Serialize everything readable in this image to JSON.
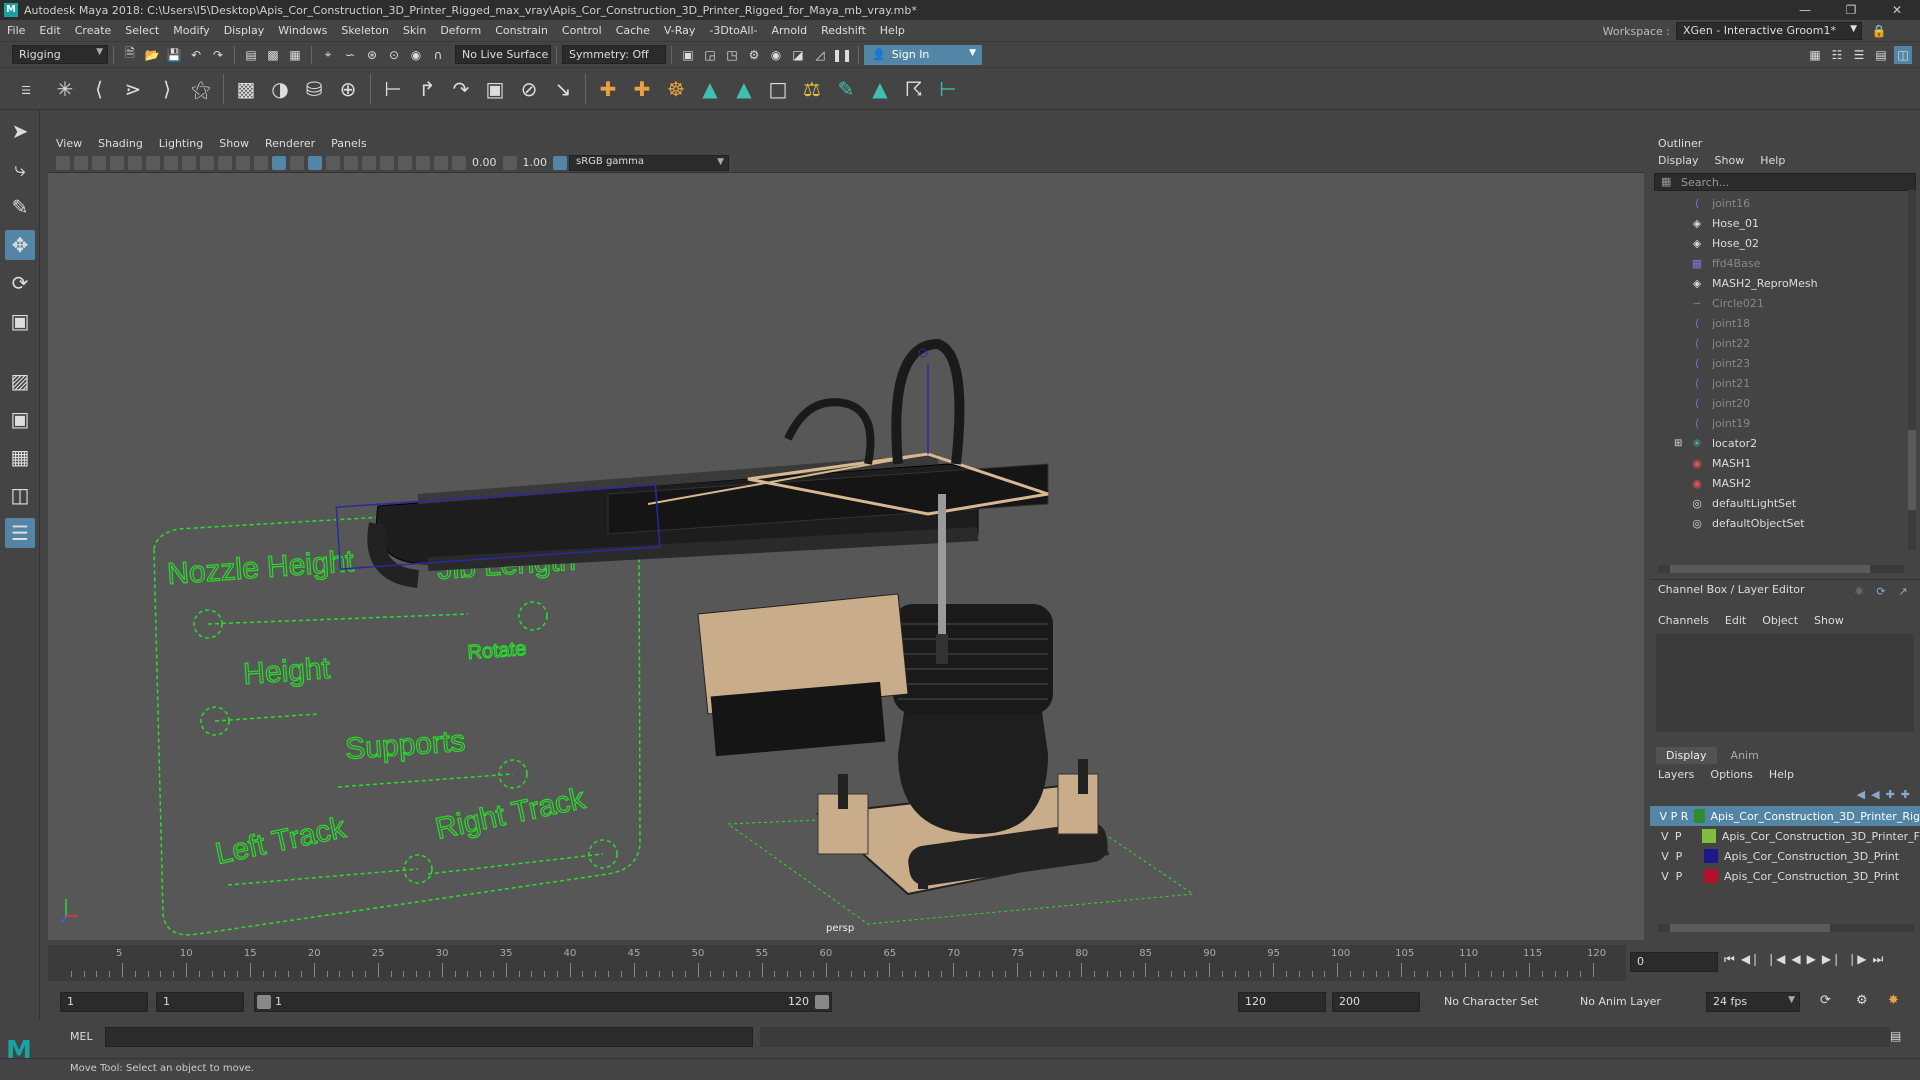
{
  "window": {
    "title": "Autodesk Maya 2018: C:\\Users\\I5\\Desktop\\Apis_Cor_Construction_3D_Printer_Rigged_max_vray\\Apis_Cor_Construction_3D_Printer_Rigged_for_Maya_mb_vray.mb*",
    "logo": "M"
  },
  "menubar": {
    "items": [
      "File",
      "Edit",
      "Create",
      "Select",
      "Modify",
      "Display",
      "Windows",
      "Skeleton",
      "Skin",
      "Deform",
      "Constrain",
      "Control",
      "Cache",
      "V-Ray",
      "-3DtoAll-",
      "Arnold",
      "Redshift",
      "Help"
    ],
    "workspace_label": "Workspace :",
    "workspace_value": "XGen - Interactive Groom1*"
  },
  "statusline": {
    "menuset": "Rigging",
    "live_surface": "No Live Surface",
    "symmetry": "Symmetry: Off",
    "sign_in": "Sign In"
  },
  "viewport": {
    "menu": [
      "View",
      "Shading",
      "Lighting",
      "Show",
      "Renderer",
      "Panels"
    ],
    "exposure": "0.00",
    "gamma": "1.00",
    "color_space": "sRGB gamma",
    "camera_label": "persp",
    "scene_text": [
      "Nozzle Height",
      "Jib Length",
      "Height",
      "Rotate",
      "Supports",
      "Left Track",
      "Right Track"
    ]
  },
  "outliner": {
    "title": "Outliner",
    "menu": [
      "Display",
      "Show",
      "Help"
    ],
    "search_placeholder": "Search...",
    "items": [
      {
        "label": "joint16",
        "icon": "joint-icon",
        "dim": true
      },
      {
        "label": "Hose_01",
        "icon": "mesh-icon",
        "dim": false
      },
      {
        "label": "Hose_02",
        "icon": "mesh-icon",
        "dim": false
      },
      {
        "label": "ffd4Base",
        "icon": "lattice-icon",
        "dim": true
      },
      {
        "label": "MASH2_ReproMesh",
        "icon": "mesh-icon",
        "dim": false
      },
      {
        "label": "Circle021",
        "icon": "curve-icon",
        "dim": true
      },
      {
        "label": "joint18",
        "icon": "joint-icon",
        "dim": true
      },
      {
        "label": "joint22",
        "icon": "joint-icon",
        "dim": true
      },
      {
        "label": "joint23",
        "icon": "joint-icon",
        "dim": true
      },
      {
        "label": "joint21",
        "icon": "joint-icon",
        "dim": true
      },
      {
        "label": "joint20",
        "icon": "joint-icon",
        "dim": true
      },
      {
        "label": "joint19",
        "icon": "joint-icon",
        "dim": true
      },
      {
        "label": "locator2",
        "icon": "locator-icon",
        "dim": false
      },
      {
        "label": "MASH1",
        "icon": "mash-icon",
        "dim": false
      },
      {
        "label": "MASH2",
        "icon": "mash-icon",
        "dim": false
      },
      {
        "label": "defaultLightSet",
        "icon": "set-icon",
        "dim": false
      },
      {
        "label": "defaultObjectSet",
        "icon": "set-icon",
        "dim": false
      }
    ]
  },
  "channelbox": {
    "title": "Channel Box / Layer Editor",
    "menu": [
      "Channels",
      "Edit",
      "Object",
      "Show"
    ]
  },
  "layers": {
    "tabs": [
      "Display",
      "Anim"
    ],
    "menu": [
      "Layers",
      "Options",
      "Help"
    ],
    "rows": [
      {
        "v": "V",
        "p": "P",
        "r": "R",
        "color": "#2e8b2e",
        "name": "Apis_Cor_Construction_3D_Printer_Rig",
        "selected": true
      },
      {
        "v": "V",
        "p": "P",
        "r": "",
        "color": "#7fbf3f",
        "name": "Apis_Cor_Construction_3D_Printer_F",
        "selected": false
      },
      {
        "v": "V",
        "p": "P",
        "r": "",
        "color": "#1a1a8c",
        "name": "Apis_Cor_Construction_3D_Print",
        "selected": false
      },
      {
        "v": "V",
        "p": "P",
        "r": "",
        "color": "#b5102a",
        "name": "Apis_Cor_Construction_3D_Print",
        "selected": false
      }
    ]
  },
  "timeline": {
    "ticks": [
      "5",
      "10",
      "15",
      "20",
      "25",
      "30",
      "35",
      "40",
      "45",
      "50",
      "55",
      "60",
      "65",
      "70",
      "75",
      "80",
      "85",
      "90",
      "95",
      "100",
      "105",
      "110",
      "115",
      "120"
    ],
    "current_frame": "0"
  },
  "range": {
    "start": "1",
    "playback_start": "1",
    "slider_start": "1",
    "slider_end": "120",
    "playback_end": "120",
    "end": "200",
    "character_set": "No Character Set",
    "anim_layer": "No Anim Layer",
    "fps": "24 fps"
  },
  "cmdline": {
    "label": "MEL",
    "help": "Move Tool: Select an object to move."
  }
}
